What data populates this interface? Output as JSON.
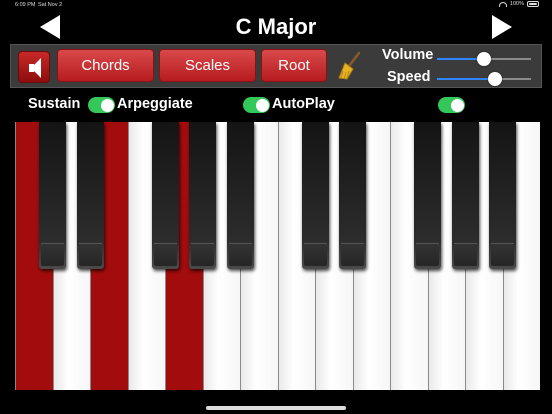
{
  "status": {
    "time": "6:09 PM",
    "date": "Sat Nov 2",
    "battery": "100%"
  },
  "header": {
    "title": "C Major"
  },
  "toolbar": {
    "chords_label": "Chords",
    "scales_label": "Scales",
    "root_label": "Root",
    "volume_label": "Volume",
    "speed_label": "Speed",
    "volume_value": 0.5,
    "speed_value": 0.62
  },
  "toggles": {
    "sustain_label": "Sustain",
    "arpeggiate_label": "Arpeggiate",
    "autoplay_label": "AutoPlay",
    "sustain_on": true,
    "arpeggiate_on": true,
    "autoplay_on": true
  },
  "keyboard": {
    "white_keys": 14,
    "highlighted_white_keys": [
      0,
      2,
      4
    ],
    "black_keys_after_white": [
      0,
      1,
      3,
      4,
      5,
      7,
      8,
      10,
      11,
      12
    ]
  },
  "colors": {
    "accent_red": "#b71c1f",
    "key_highlight": "#a30c0c",
    "switch_green": "#34c759",
    "slider_blue": "#2f86ff"
  }
}
